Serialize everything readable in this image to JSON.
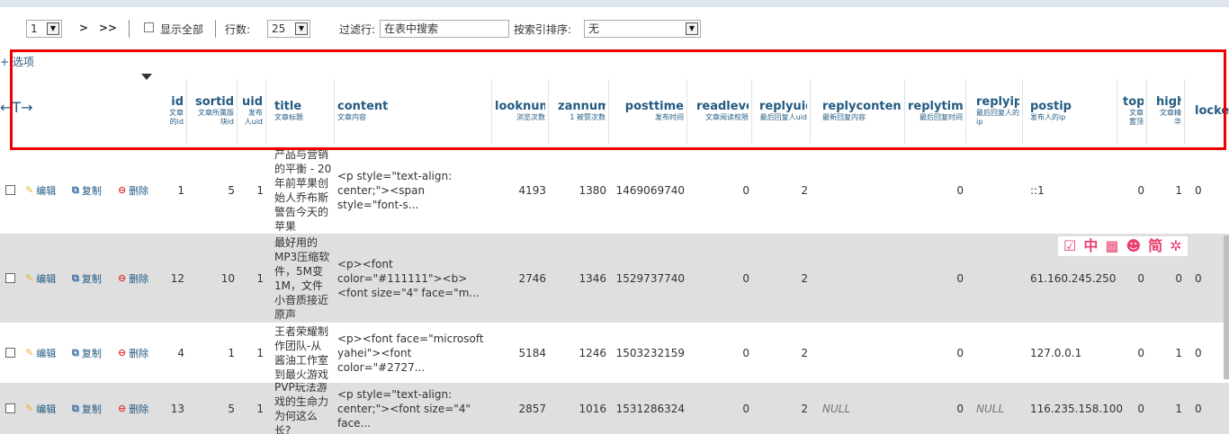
{
  "nav": {
    "page_select": "1",
    "next": ">",
    "last": ">>",
    "show_all": "显示全部",
    "rows_label": "行数:",
    "rows_value": "25",
    "filter_label": "过滤行:",
    "filter_placeholder": "在表中搜索",
    "sort_label": "按索引排序:",
    "sort_value": "无"
  },
  "options_label": "+ 选项",
  "toggle_label": "←T→",
  "columns": [
    {
      "key": "id",
      "name": "id",
      "desc": "文章的id"
    },
    {
      "key": "sortid",
      "name": "sortid",
      "desc": "文章所属版块id"
    },
    {
      "key": "uid",
      "name": "uid",
      "desc": "发布人uid"
    },
    {
      "key": "title",
      "name": "title",
      "desc": "文章标题"
    },
    {
      "key": "content",
      "name": "content",
      "desc": "文章内容"
    },
    {
      "key": "looknum",
      "name": "looknum",
      "desc": "浏览次数"
    },
    {
      "key": "zannum",
      "name": "zannum",
      "desc": "1 被赞次数"
    },
    {
      "key": "posttime",
      "name": "posttime",
      "desc": "发布时间"
    },
    {
      "key": "readlevel",
      "name": "readlevel",
      "desc": "文章阅读权限"
    },
    {
      "key": "replyuid",
      "name": "replyuid",
      "desc": "最后回复人uid"
    },
    {
      "key": "replycontent",
      "name": "replycontent",
      "desc": "最新回复内容"
    },
    {
      "key": "replytime",
      "name": "replytime",
      "desc": "最后回复时间"
    },
    {
      "key": "replyip",
      "name": "replyip",
      "desc": "最后回复人的ip"
    },
    {
      "key": "postip",
      "name": "postip",
      "desc": "发布人的ip"
    },
    {
      "key": "top",
      "name": "top",
      "desc": "文章置顶"
    },
    {
      "key": "high",
      "name": "high",
      "desc": "文章精华"
    },
    {
      "key": "locked",
      "name": "locke",
      "desc": ""
    }
  ],
  "actions": {
    "edit": "编辑",
    "copy": "复制",
    "delete": "删除"
  },
  "rows": [
    {
      "id": "1",
      "sortid": "5",
      "uid": "1",
      "title": "产品与营销的平衡 - 20年前苹果创始人乔布斯警告今天的苹果",
      "content": "<p style=\"text-align: center;\"><span style=\"font-s...",
      "looknum": "4193",
      "zannum": "1380",
      "posttime": "1469069740",
      "readlevel": "0",
      "replyuid": "2",
      "replycontent": "",
      "replytime": "0",
      "replyip": "",
      "postip": "::1",
      "top": "0",
      "high": "1",
      "locked": "0"
    },
    {
      "id": "12",
      "sortid": "10",
      "uid": "1",
      "title": "最好用的MP3压缩软件，5M变1M，文件小音质接近原声",
      "content": "<p><font color=\"#111111\"><b><font size=\"4\" face=\"m...",
      "looknum": "2746",
      "zannum": "1346",
      "posttime": "1529737740",
      "readlevel": "0",
      "replyuid": "2",
      "replycontent": "",
      "replytime": "0",
      "replyip": "",
      "postip": "61.160.245.250",
      "top": "0",
      "high": "0",
      "locked": "0"
    },
    {
      "id": "4",
      "sortid": "1",
      "uid": "1",
      "title": "王者荣耀制作团队-从酱油工作室到最火游戏",
      "content": "<p><font face=\"microsoft yahei\"><font color=\"#2727...",
      "looknum": "5184",
      "zannum": "1246",
      "posttime": "1503232159",
      "readlevel": "0",
      "replyuid": "2",
      "replycontent": "",
      "replytime": "0",
      "replyip": "",
      "postip": "127.0.0.1",
      "top": "0",
      "high": "1",
      "locked": "0"
    },
    {
      "id": "13",
      "sortid": "5",
      "uid": "1",
      "title": "PVP玩法游戏的生命力为何这么长?",
      "content": "<p style=\"text-align: center;\"><font size=\"4\" face...",
      "looknum": "2857",
      "zannum": "1016",
      "posttime": "1531286324",
      "readlevel": "0",
      "replyuid": "2",
      "replycontent": "NULL",
      "replytime": "0",
      "replyip": "NULL",
      "postip": "116.235.158.100",
      "top": "0",
      "high": "1",
      "locked": "0"
    }
  ],
  "ime_bar": [
    "☑",
    "中",
    "▦",
    "☻",
    "简",
    "✲"
  ]
}
